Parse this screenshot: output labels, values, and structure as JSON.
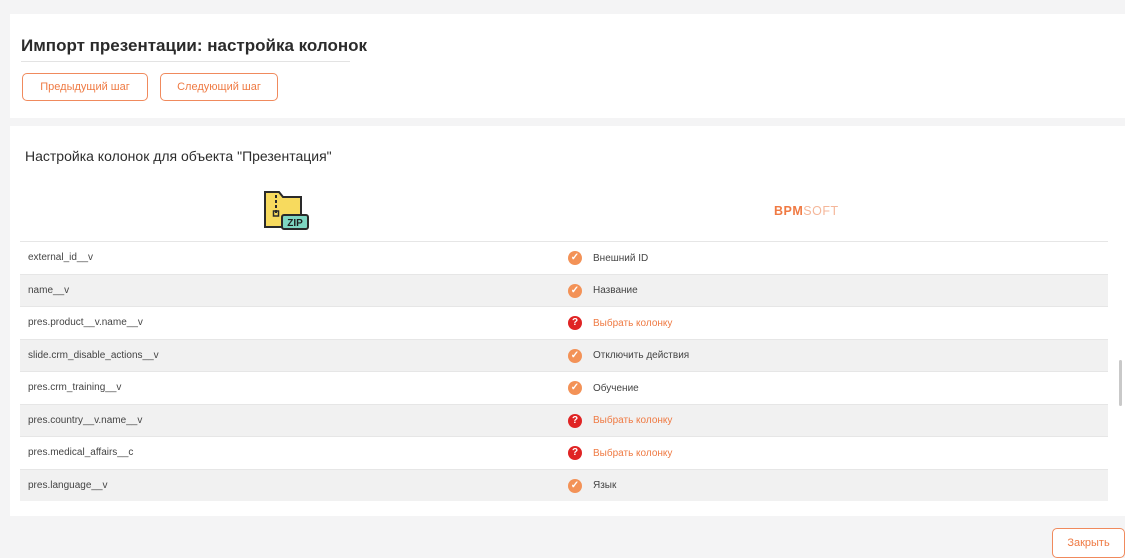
{
  "header": {
    "title": "Импорт презентации: настройка колонок",
    "prev_label": "Предыдущий шаг",
    "next_label": "Следующий шаг"
  },
  "section": {
    "title": "Настройка колонок для объекта \"Презентация\""
  },
  "source": {
    "icon": "zip-archive-icon",
    "icon_text": "ZIP"
  },
  "target": {
    "logo_part1": "BPM",
    "logo_part2": "SOFT",
    "logo_text": "BPMSOFT"
  },
  "rows": [
    {
      "source": "external_id__v",
      "status": "ok",
      "target": "Внешний ID"
    },
    {
      "source": "name__v",
      "status": "ok",
      "target": "Название"
    },
    {
      "source": "pres.product__v.name__v",
      "status": "missing",
      "target": "Выбрать колонку"
    },
    {
      "source": "slide.crm_disable_actions__v",
      "status": "ok",
      "target": "Отключить действия"
    },
    {
      "source": "pres.crm_training__v",
      "status": "ok",
      "target": "Обучение"
    },
    {
      "source": "pres.country__v.name__v",
      "status": "missing",
      "target": "Выбрать колонку"
    },
    {
      "source": "pres.medical_affairs__c",
      "status": "missing",
      "target": "Выбрать колонку"
    },
    {
      "source": "pres.language__v",
      "status": "ok",
      "target": "Язык"
    }
  ],
  "icons": {
    "ok": "✓",
    "missing": "?"
  },
  "footer": {
    "close_label": "Закрыть"
  },
  "colors": {
    "accent": "#ef7a43",
    "ok": "#f39257",
    "missing": "#e02424"
  }
}
